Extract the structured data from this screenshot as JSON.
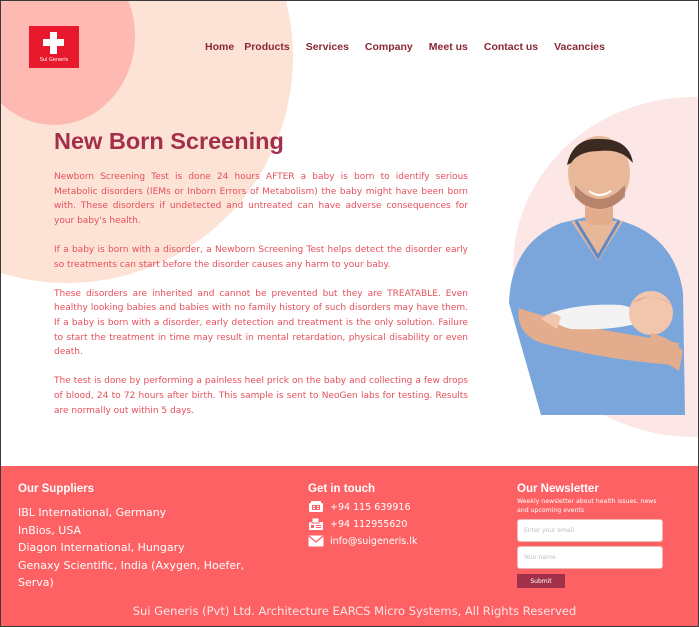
{
  "brand": {
    "logo_text": "Sui Generis"
  },
  "nav": {
    "items": [
      "Home",
      "Products",
      "Services",
      "Company",
      "Meet us",
      "Contact us",
      "Vacancies"
    ]
  },
  "main": {
    "title": "New Born Screening",
    "paragraphs": [
      "Newborn Screening Test is done 24 hours AFTER a  baby is born to identify serious Metabolic disorders (IEMs or Inborn  Errors of Metabolism) the baby might have been born with. These  disorders if undetected and untreated can have adverse consequences for  your baby's health.",
      " If a baby is born with a disorder, a Newborn  Screening Test helps detect the disorder early so treatments can start  before the disorder causes any harm to your baby.",
      "These disorders are inherited and cannot be  prevented but they are TREATABLE. Even healthy looking babies and babies  with no family history of such disorders may have them. If a baby is  born with a disorder, early detection and treatment is the only solution. Failure to start the treatment in time may result in mental  retardation, physical disability or even death.",
      "The test is done by performing a painless heel  prick on the baby and collecting a few drops of blood, 24 to 72 hours  after birth. This sample is sent to NeoGen labs for testing. Results are  normally out within 5 days."
    ]
  },
  "footer": {
    "suppliers_heading": "Our Suppliers",
    "suppliers": [
      "IBL International, Germany",
      "InBios, USA",
      "Diagon International, Hungary",
      "Genaxy Scientific, India (Axygen, Hoefer, Serva)"
    ],
    "contact_heading": "Get in touch",
    "contacts": [
      {
        "icon": "phone-icon",
        "text": "+94 115 639916"
      },
      {
        "icon": "fax-icon",
        "text": "+94 112955620"
      },
      {
        "icon": "mail-icon",
        "text": "info@suigeneris.lk"
      }
    ],
    "newsletter": {
      "heading": "Our Newsletter",
      "description": "Weekly newsletter about health issues, news and upcoming events",
      "email_placeholder": "Enter your email",
      "name_placeholder": "Your name",
      "submit_label": "Submit"
    },
    "copyright": "Sui Generis (Pvt) Ltd. Architecture EARCS Micro Systems, All Rights Reserved"
  },
  "colors": {
    "brand_red": "#e8192c",
    "accent": "#a3304a",
    "footer_bg": "#fd6163",
    "body_text": "#e6505a"
  }
}
